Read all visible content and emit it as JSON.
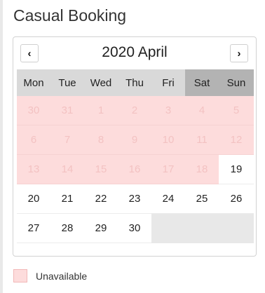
{
  "title": "Casual Booking",
  "calendar": {
    "prev_icon": "‹",
    "next_icon": "›",
    "month_label": "2020 April",
    "weekdays": [
      "Mon",
      "Tue",
      "Wed",
      "Thu",
      "Fri",
      "Sat",
      "Sun"
    ],
    "weeks": [
      [
        {
          "d": "30",
          "s": "unavailable"
        },
        {
          "d": "31",
          "s": "unavailable"
        },
        {
          "d": "1",
          "s": "unavailable"
        },
        {
          "d": "2",
          "s": "unavailable"
        },
        {
          "d": "3",
          "s": "unavailable"
        },
        {
          "d": "4",
          "s": "unavailable"
        },
        {
          "d": "5",
          "s": "unavailable"
        }
      ],
      [
        {
          "d": "6",
          "s": "unavailable"
        },
        {
          "d": "7",
          "s": "unavailable"
        },
        {
          "d": "8",
          "s": "unavailable"
        },
        {
          "d": "9",
          "s": "unavailable"
        },
        {
          "d": "10",
          "s": "unavailable"
        },
        {
          "d": "11",
          "s": "unavailable"
        },
        {
          "d": "12",
          "s": "unavailable"
        }
      ],
      [
        {
          "d": "13",
          "s": "unavailable"
        },
        {
          "d": "14",
          "s": "unavailable"
        },
        {
          "d": "15",
          "s": "unavailable"
        },
        {
          "d": "16",
          "s": "unavailable"
        },
        {
          "d": "17",
          "s": "unavailable"
        },
        {
          "d": "18",
          "s": "unavailable"
        },
        {
          "d": "19",
          "s": "available"
        }
      ],
      [
        {
          "d": "20",
          "s": "available"
        },
        {
          "d": "21",
          "s": "available"
        },
        {
          "d": "22",
          "s": "available"
        },
        {
          "d": "23",
          "s": "available"
        },
        {
          "d": "24",
          "s": "available"
        },
        {
          "d": "25",
          "s": "available"
        },
        {
          "d": "26",
          "s": "available"
        }
      ],
      [
        {
          "d": "27",
          "s": "available"
        },
        {
          "d": "28",
          "s": "available"
        },
        {
          "d": "29",
          "s": "available"
        },
        {
          "d": "30",
          "s": "available"
        },
        {
          "d": "",
          "s": "empty"
        },
        {
          "d": "",
          "s": "empty"
        },
        {
          "d": "",
          "s": "empty"
        }
      ]
    ]
  },
  "legend": {
    "label": "Unavailable",
    "color": "#fddcdc"
  }
}
